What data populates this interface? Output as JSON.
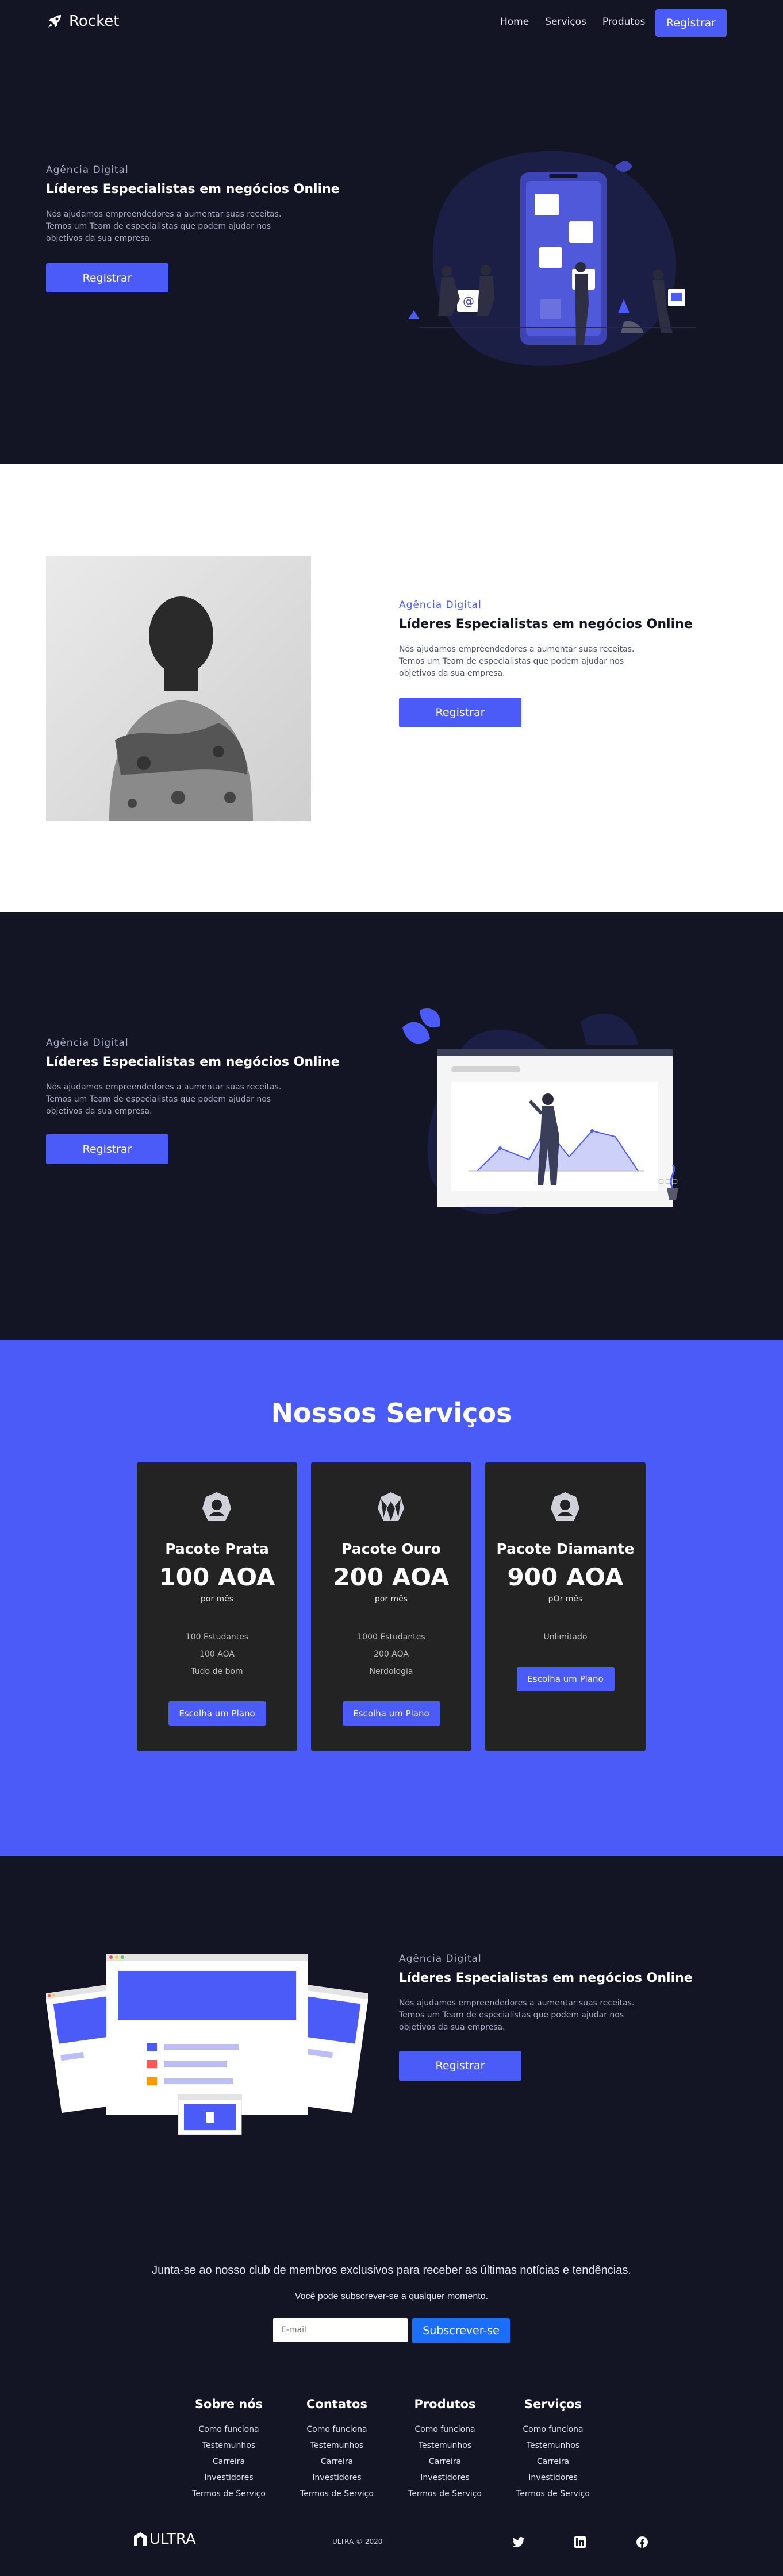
{
  "nav": {
    "brand": "Rocket",
    "links": [
      "Home",
      "Serviços",
      "Produtos"
    ],
    "register": "Registrar"
  },
  "hero": {
    "kicker": "Agência Digital",
    "title": "Líderes Especialistas em negócios Online",
    "desc": "Nós ajudamos empreendedores a aumentar suas receitas. Temos um Team de especialistas que podem ajudar nos objetivos da sua empresa.",
    "button": "Registrar"
  },
  "about": {
    "kicker": "Agência Digital",
    "title": "Líderes Especialistas em negócios Online",
    "desc": "Nós ajudamos empreendedores a aumentar suas receitas. Temos um Team de especialistas que podem ajudar nos objetivos da sua empresa.",
    "button": "Registrar"
  },
  "analytics": {
    "kicker": "Agência Digital",
    "title": "Líderes Especialistas em negócios Online",
    "desc": "Nós ajudamos empreendedores a aumentar suas receitas. Temos um Team de especialistas que podem ajudar nos objetivos da sua empresa.",
    "button": "Registrar"
  },
  "services": {
    "heading": "Nossos Serviços",
    "plans": [
      {
        "name": "Pacote Prata",
        "price": "100 AOA",
        "period": "por mês",
        "features": [
          "100 Estudantes",
          "100 AOA",
          "Tudo de bom"
        ],
        "button": "Escolha um Plano"
      },
      {
        "name": "Pacote Ouro",
        "price": "200 AOA",
        "period": "por mês",
        "features": [
          "1000 Estudantes",
          "200 AOA",
          "Nerdologia"
        ],
        "button": "Escolha um Plano"
      },
      {
        "name": "Pacote Diamante",
        "price": "900 AOA",
        "period": "pOr mês",
        "features": [
          "Unlimitado"
        ],
        "button": "Escolha um Plano"
      }
    ]
  },
  "web": {
    "kicker": "Agência Digital",
    "title": "Líderes Especialistas em negócios Online",
    "desc": "Nós ajudamos empreendedores a aumentar suas receitas. Temos um Team de especialistas que podem ajudar nos objetivos da sua empresa.",
    "button": "Registrar"
  },
  "newsletter": {
    "headline": "Junta-se ao nosso club de membros exclusivos para receber as últimas notícias e tendências.",
    "sub": "Você pode subscrever-se a qualquer momento.",
    "placeholder": "E-mail",
    "button": "Subscrever-se"
  },
  "footer": {
    "columns": [
      {
        "title": "Sobre nós",
        "links": [
          "Como funciona",
          "Testemunhos",
          "Carreira",
          "Investidores",
          "Termos de Serviço"
        ]
      },
      {
        "title": "Contatos",
        "links": [
          "Como funciona",
          "Testemunhos",
          "Carreira",
          "Investidores",
          "Termos de Serviço"
        ]
      },
      {
        "title": "Produtos",
        "links": [
          "Como funciona",
          "Testemunhos",
          "Carreira",
          "Investidores",
          "Termos de Serviço"
        ]
      },
      {
        "title": "Serviços",
        "links": [
          "Como funciona",
          "Testemunhos",
          "Carreira",
          "Investidores",
          "Termos de Serviço"
        ]
      }
    ],
    "logo": "ULTRA",
    "copyright": "ULTRA © 2020",
    "social": [
      "twitter-icon",
      "linkedin-icon",
      "facebook-icon"
    ]
  },
  "colors": {
    "accent": "#4a5bf7",
    "dark": "#131524",
    "card": "#232323"
  }
}
